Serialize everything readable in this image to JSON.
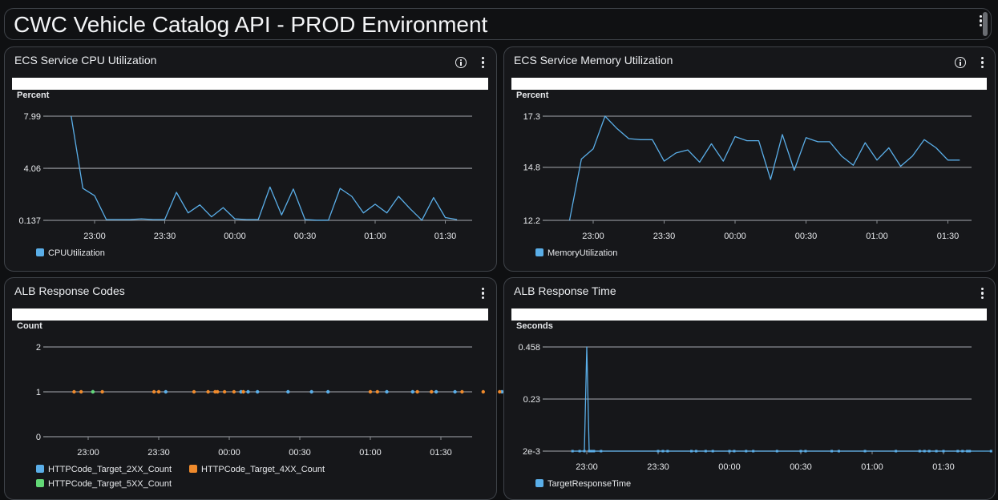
{
  "dashboard": {
    "title": "CWC Vehicle Catalog API - PROD Environment"
  },
  "colors": {
    "blue": "#5aaee8",
    "orange": "#ef8a2c",
    "green": "#62d876",
    "grid": "#8a8d92",
    "text": "#e6e8eb"
  },
  "panels": [
    {
      "title": "ECS Service CPU Utilization",
      "unit": "Percent",
      "has_info": true,
      "legend": [
        {
          "label": "CPUUtilization",
          "color": "#5aaee8"
        }
      ]
    },
    {
      "title": "ECS Service Memory Utilization",
      "unit": "Percent",
      "has_info": true,
      "legend": [
        {
          "label": "MemoryUtilization",
          "color": "#5aaee8"
        }
      ]
    },
    {
      "title": "ALB Response Codes",
      "unit": "Count",
      "has_info": false,
      "legend": [
        {
          "label": "HTTPCode_Target_2XX_Count",
          "color": "#5aaee8"
        },
        {
          "label": "HTTPCode_Target_4XX_Count",
          "color": "#ef8a2c"
        },
        {
          "label": "HTTPCode_Target_5XX_Count",
          "color": "#62d876"
        }
      ]
    },
    {
      "title": "ALB Response Time",
      "unit": "Seconds",
      "has_info": false,
      "legend": [
        {
          "label": "TargetResponseTime",
          "color": "#5aaee8"
        }
      ]
    }
  ],
  "chart_data": [
    {
      "type": "line",
      "title": "ECS Service CPU Utilization",
      "ylabel": "Percent",
      "ylim": [
        0.137,
        7.99
      ],
      "yticks": [
        "7.99",
        "4.06",
        "0.137"
      ],
      "ytick_values": [
        7.99,
        4.06,
        0.137
      ],
      "xlim_minutes": [
        -22,
        127
      ],
      "xticks": [
        "23:00",
        "23:30",
        "00:00",
        "00:30",
        "01:00",
        "01:30"
      ],
      "xtick_minutes": [
        0,
        30,
        60,
        90,
        120,
        150
      ],
      "grid": true,
      "legend_position": "bottom-left",
      "series": [
        {
          "name": "CPUUtilization",
          "color": "#5aaee8",
          "x_minutes": [
            -10,
            -5,
            0,
            5,
            10,
            15,
            20,
            25,
            30,
            35,
            40,
            45,
            50,
            55,
            60,
            65,
            70,
            75,
            80,
            85,
            90,
            95,
            100,
            105,
            110,
            115,
            120,
            125,
            130,
            135,
            140,
            145,
            150,
            155
          ],
          "values": [
            7.99,
            2.55,
            2.0,
            0.2,
            0.2,
            0.2,
            0.25,
            0.2,
            0.2,
            2.25,
            0.7,
            1.3,
            0.4,
            1.1,
            0.25,
            0.2,
            0.2,
            2.65,
            0.55,
            2.5,
            0.2,
            0.15,
            0.15,
            2.55,
            1.95,
            0.7,
            1.35,
            0.7,
            1.95,
            1.0,
            0.15,
            1.85,
            0.35,
            0.2
          ]
        }
      ]
    },
    {
      "type": "line",
      "title": "ECS Service Memory Utilization",
      "ylabel": "Percent",
      "ylim": [
        12.2,
        17.3
      ],
      "yticks": [
        "17.3",
        "14.8",
        "12.2"
      ],
      "ytick_values": [
        17.3,
        14.8,
        12.2
      ],
      "xticks": [
        "23:00",
        "23:30",
        "00:00",
        "00:30",
        "01:00",
        "01:30"
      ],
      "xtick_minutes": [
        0,
        30,
        60,
        90,
        120,
        150
      ],
      "grid": true,
      "legend_position": "bottom-left",
      "series": [
        {
          "name": "MemoryUtilization",
          "color": "#5aaee8",
          "x_minutes": [
            -10,
            -5,
            0,
            5,
            10,
            15,
            20,
            25,
            30,
            35,
            40,
            45,
            50,
            55,
            60,
            65,
            70,
            75,
            80,
            85,
            90,
            95,
            100,
            105,
            110,
            115,
            120,
            125,
            130,
            135,
            140,
            145,
            150,
            155
          ],
          "values": [
            12.2,
            15.2,
            15.7,
            17.3,
            16.7,
            16.2,
            16.15,
            16.15,
            15.1,
            15.5,
            15.65,
            15.05,
            15.95,
            15.1,
            16.3,
            16.1,
            16.1,
            14.2,
            16.4,
            14.65,
            16.25,
            16.05,
            16.05,
            15.35,
            14.9,
            16.0,
            15.15,
            15.75,
            14.85,
            15.35,
            16.15,
            15.75,
            15.15,
            15.15
          ]
        }
      ]
    },
    {
      "type": "scatter",
      "title": "ALB Response Codes",
      "ylabel": "Count",
      "ylim": [
        0,
        2
      ],
      "yticks": [
        "2",
        "1",
        "0"
      ],
      "ytick_values": [
        2,
        1,
        0
      ],
      "xticks": [
        "23:00",
        "23:30",
        "00:00",
        "00:30",
        "01:00",
        "01:30"
      ],
      "xtick_minutes": [
        0,
        30,
        60,
        90,
        120,
        150
      ],
      "grid": true,
      "legend_position": "bottom-left",
      "series": [
        {
          "name": "HTTPCode_Target_2XX_Count",
          "color": "#5aaee8",
          "x_minutes": [
            2,
            33,
            65,
            68,
            72,
            85,
            95,
            102,
            127,
            138,
            148,
            156,
            176
          ],
          "values": [
            1,
            1,
            1,
            1,
            1,
            1,
            1,
            1,
            1,
            1,
            1,
            1,
            1
          ]
        },
        {
          "name": "HTTPCode_Target_4XX_Count",
          "color": "#ef8a2c",
          "x_minutes": [
            -6,
            -3,
            6,
            28,
            30,
            45,
            51,
            54,
            55,
            58,
            62,
            66,
            120,
            123,
            140,
            146,
            159,
            168,
            175,
            183
          ],
          "values": [
            1,
            1,
            1,
            1,
            1,
            1,
            1,
            1,
            1,
            1,
            1,
            1,
            1,
            1,
            1,
            1,
            1,
            1,
            1,
            1
          ]
        },
        {
          "name": "HTTPCode_Target_5XX_Count",
          "color": "#62d876",
          "x_minutes": [
            2
          ],
          "values": [
            1
          ]
        }
      ]
    },
    {
      "type": "line",
      "title": "ALB Response Time",
      "ylabel": "Seconds",
      "ylim": [
        0.002,
        0.458
      ],
      "yticks": [
        "0.458",
        "0.23",
        "2e-3"
      ],
      "ytick_values": [
        0.458,
        0.23,
        0.002
      ],
      "xticks": [
        "23:00",
        "23:30",
        "00:00",
        "00:30",
        "01:00",
        "01:30"
      ],
      "xtick_minutes": [
        0,
        30,
        60,
        90,
        120,
        150
      ],
      "grid": true,
      "legend_position": "bottom-left",
      "series": [
        {
          "name": "TargetResponseTime",
          "color": "#5aaee8",
          "x_minutes": [
            -6,
            -3,
            -1,
            0,
            1,
            1.5,
            2,
            3,
            6,
            30,
            32,
            34,
            44,
            46,
            50,
            53,
            60,
            62,
            67,
            70,
            80,
            90,
            92,
            103,
            106,
            117,
            130,
            140,
            142,
            144,
            147,
            150,
            156,
            158,
            160,
            161,
            170
          ],
          "values": [
            0.002,
            0.002,
            0.002,
            0.458,
            0.002,
            0.002,
            0.002,
            0.002,
            0.002,
            0.002,
            0.002,
            0.002,
            0.002,
            0.002,
            0.002,
            0.002,
            0.002,
            0.002,
            0.002,
            0.002,
            0.002,
            0.002,
            0.002,
            0.002,
            0.002,
            0.002,
            0.002,
            0.002,
            0.002,
            0.002,
            0.002,
            0.002,
            0.002,
            0.002,
            0.002,
            0.002,
            0.002
          ]
        }
      ]
    }
  ]
}
